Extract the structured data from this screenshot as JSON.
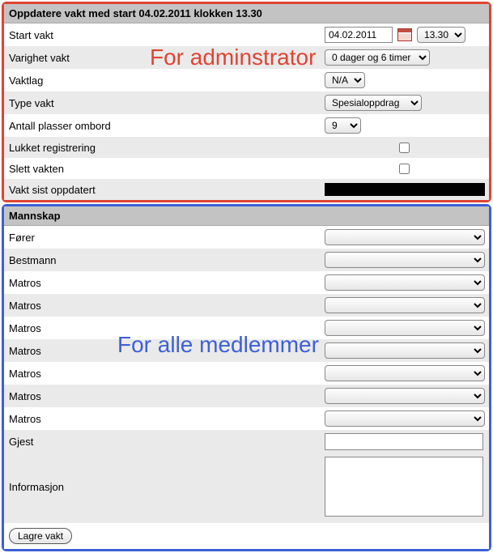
{
  "admin": {
    "overlay": "For adminstrator",
    "header": "Oppdatere vakt med start 04.02.2011 klokken 13.30",
    "rows": {
      "start_label": "Start vakt",
      "start_date": "04.02.2011",
      "start_time": "13.30",
      "duration_label": "Varighet vakt",
      "duration_value": "0 dager og 6 timer",
      "vaktlag_label": "Vaktlag",
      "vaktlag_value": "N/A",
      "type_label": "Type vakt",
      "type_value": "Spesialoppdrag",
      "places_label": "Antall plasser ombord",
      "places_value": "9",
      "closed_label": "Lukket registrering",
      "delete_label": "Slett vakten",
      "updated_label": "Vakt sist oppdatert"
    }
  },
  "crew": {
    "overlay": "For alle medlemmer",
    "header": "Mannskap",
    "roles": [
      "Fører",
      "Bestmann",
      "Matros",
      "Matros",
      "Matros",
      "Matros",
      "Matros",
      "Matros",
      "Matros"
    ],
    "gjest_label": "Gjest",
    "gjest_value": "",
    "info_label": "Informasjon",
    "info_value": "",
    "save_label": "Lagre vakt"
  }
}
